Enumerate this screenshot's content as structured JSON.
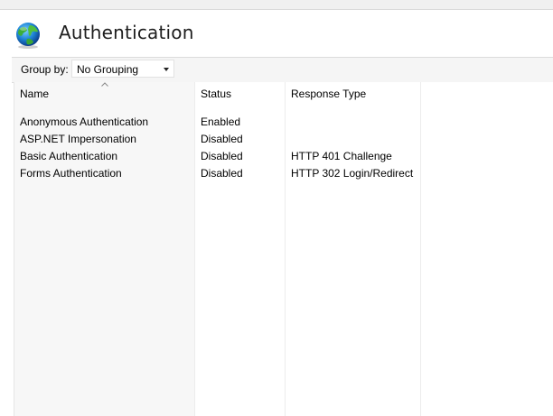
{
  "header": {
    "title": "Authentication",
    "icon": "globe-icon"
  },
  "toolbar": {
    "group_by_label": "Group by:",
    "group_by_value": "No Grouping"
  },
  "table": {
    "columns": [
      "Name",
      "Status",
      "Response Type"
    ],
    "sort_column": "Name",
    "rows": [
      {
        "name": "Anonymous Authentication",
        "status": "Enabled",
        "response": ""
      },
      {
        "name": "ASP.NET Impersonation",
        "status": "Disabled",
        "response": ""
      },
      {
        "name": "Basic Authentication",
        "status": "Disabled",
        "response": "HTTP 401 Challenge"
      },
      {
        "name": "Forms Authentication",
        "status": "Disabled",
        "response": "HTTP 302 Login/Redirect"
      }
    ]
  },
  "colors": {
    "panel_bg": "#ffffff",
    "window_bg": "#f0f0f0",
    "name_column_bg": "#f7f7f7"
  }
}
